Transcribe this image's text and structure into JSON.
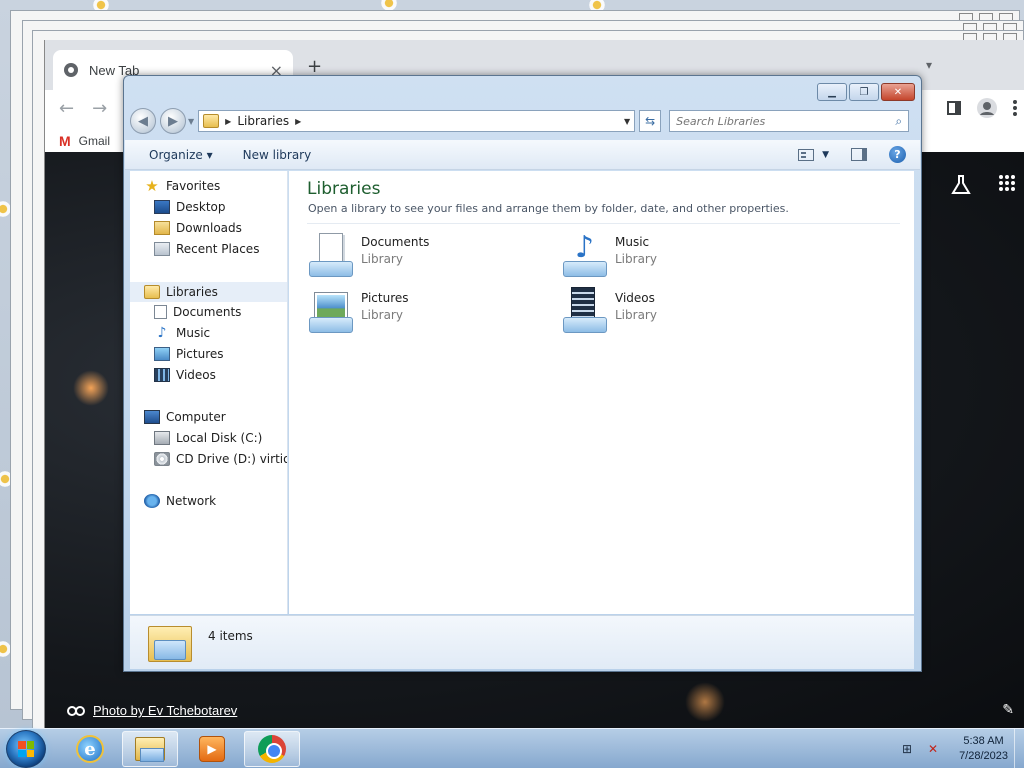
{
  "chrome": {
    "tab_title": "New Tab",
    "tab_close": "×",
    "new_tab": "+",
    "back": "←",
    "forward": "→",
    "bookmark_gmail_icon": "M",
    "bookmark_gmail": "Gmail",
    "photo_credit": "Photo by Ev Tchebotarev",
    "icons": [
      "chrome-logo-icon",
      "side-panel-icon",
      "profile-icon",
      "more-icon",
      "labs-icon",
      "apps-grid-icon",
      "link-icon",
      "pencil-icon"
    ]
  },
  "explorer": {
    "breadcrumb": "Libraries",
    "search_placeholder": "Search Libraries",
    "commands": {
      "organize": "Organize",
      "new_library": "New library"
    },
    "nav": {
      "favorites": "Favorites",
      "desktop": "Desktop",
      "downloads": "Downloads",
      "recent_places": "Recent Places",
      "libraries": "Libraries",
      "documents": "Documents",
      "music": "Music",
      "pictures": "Pictures",
      "videos": "Videos",
      "computer": "Computer",
      "local_disk": "Local Disk (C:)",
      "cd_drive": "CD Drive (D:) virtio-win",
      "network": "Network"
    },
    "content": {
      "title": "Libraries",
      "subtitle": "Open a library to see your files and arrange them by folder, date, and other properties.",
      "libraries": [
        {
          "name": "Documents",
          "type": "Library"
        },
        {
          "name": "Music",
          "type": "Library"
        },
        {
          "name": "Pictures",
          "type": "Library"
        },
        {
          "name": "Videos",
          "type": "Library"
        }
      ]
    },
    "details": {
      "count": "4 items"
    }
  },
  "taskbar": {
    "time": "5:38 AM",
    "date": "7/28/2023",
    "ie_letter": "e"
  },
  "colors": {
    "library_title": "#1e5e2f",
    "command_text": "#1e395b",
    "close_button": "#c4452c"
  }
}
